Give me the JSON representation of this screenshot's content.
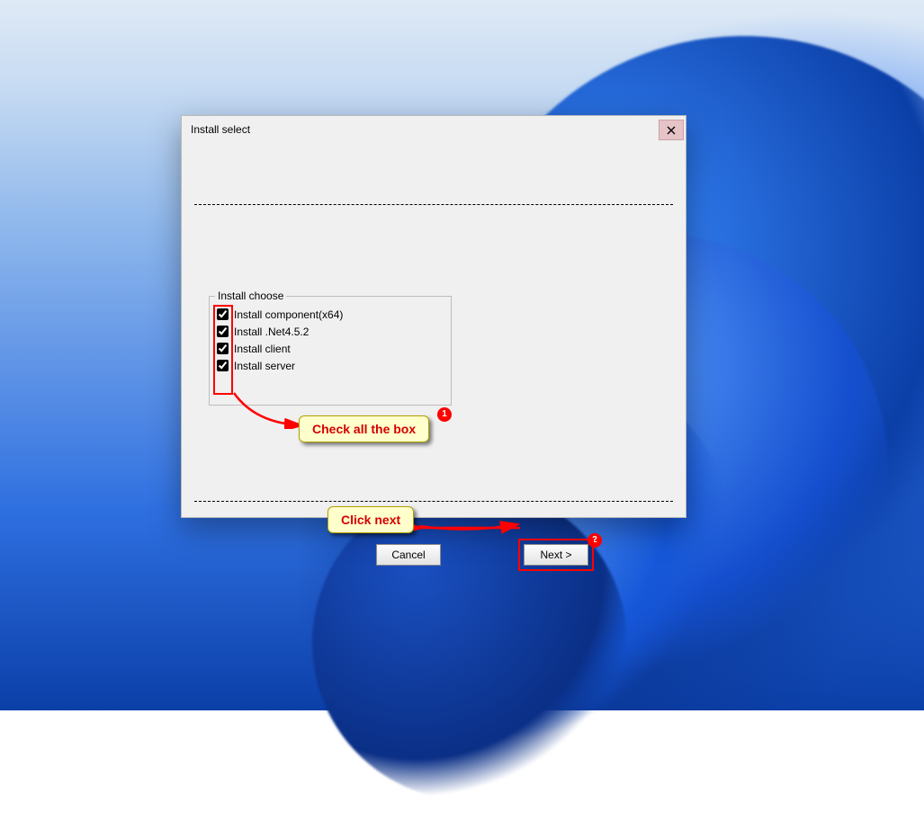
{
  "dialog": {
    "title": "Install select",
    "group_legend": "Install choose",
    "checks": {
      "component": {
        "label": "Install component(x64)",
        "checked": true
      },
      "dotnet": {
        "label": "Install .Net4.5.2",
        "checked": true
      },
      "client": {
        "label": "Install client",
        "checked": true
      },
      "server": {
        "label": "Install server",
        "checked": true
      }
    },
    "buttons": {
      "cancel": "Cancel",
      "next": "Next >"
    }
  },
  "annotations": {
    "callout1": "Check all the box",
    "callout2": "Click next",
    "badge1": "1",
    "badge2": "2"
  }
}
